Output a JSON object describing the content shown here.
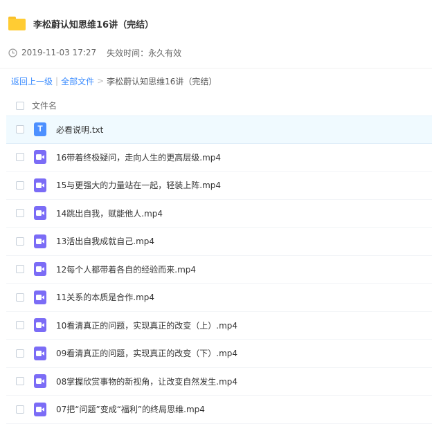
{
  "header": {
    "title": "李松蔚认知思维16讲（完结）",
    "icon": "folder-icon"
  },
  "meta": {
    "date": "2019-11-03 17:27",
    "expiry": "失效时间：永久有效"
  },
  "breadcrumb": {
    "back": "返回上一级",
    "divider": "|",
    "all_files": "全部文件",
    "arrow": ">",
    "current": "李松蔚认知思维16讲（完结）"
  },
  "table": {
    "column_name": "文件名"
  },
  "files": [
    {
      "name": "必看说明.txt",
      "type": "txt",
      "icon_glyph": "T"
    },
    {
      "name": "16带着终极疑问，走向人生的更高层级.mp4",
      "type": "video"
    },
    {
      "name": "15与更强大的力量站在一起，轻装上阵.mp4",
      "type": "video"
    },
    {
      "name": "14跳出自我，赋能他人.mp4",
      "type": "video"
    },
    {
      "name": "13活出自我成就自己.mp4",
      "type": "video"
    },
    {
      "name": "12每个人都带着各自的经验而来.mp4",
      "type": "video"
    },
    {
      "name": "11关系的本质是合作.mp4",
      "type": "video"
    },
    {
      "name": "10看清真正的问题，实现真正的改变（上）.mp4",
      "type": "video"
    },
    {
      "name": "09看清真正的问题，实现真正的改变（下）.mp4",
      "type": "video"
    },
    {
      "name": "08掌握欣赏事物的新视角，让改变自然发生.mp4",
      "type": "video"
    },
    {
      "name": "07把“问题”变成“福利”的终局思维.mp4",
      "type": "video"
    }
  ],
  "colors": {
    "link": "#3b8cff",
    "folder": "#ffcc33",
    "txt_icon": "#4d90ff",
    "video_icon": "#7b6cf6",
    "selected_row": "#f0faff"
  }
}
